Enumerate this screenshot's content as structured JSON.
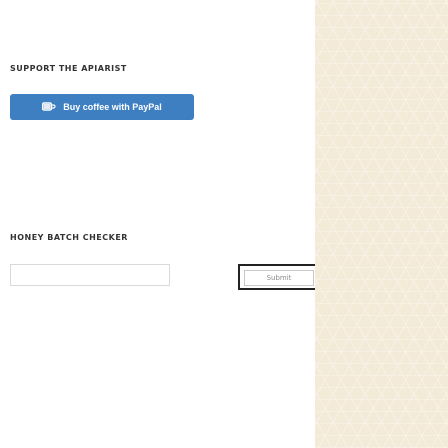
{
  "support": {
    "heading": "SUPPORT THE APIARIST",
    "paypal_button_label": "Buy coffee with PayPal"
  },
  "checker": {
    "heading": "HONEY BATCH CHECKER",
    "input_value": "",
    "submit_label": "Submit"
  },
  "icons": {
    "paypal": "coffee-cup-icon"
  },
  "colors": {
    "paypal_button": "#3d7fc1",
    "heading_text": "#333333",
    "side_panel": "#f3ead8",
    "submit_text": "#8d8d8d"
  }
}
